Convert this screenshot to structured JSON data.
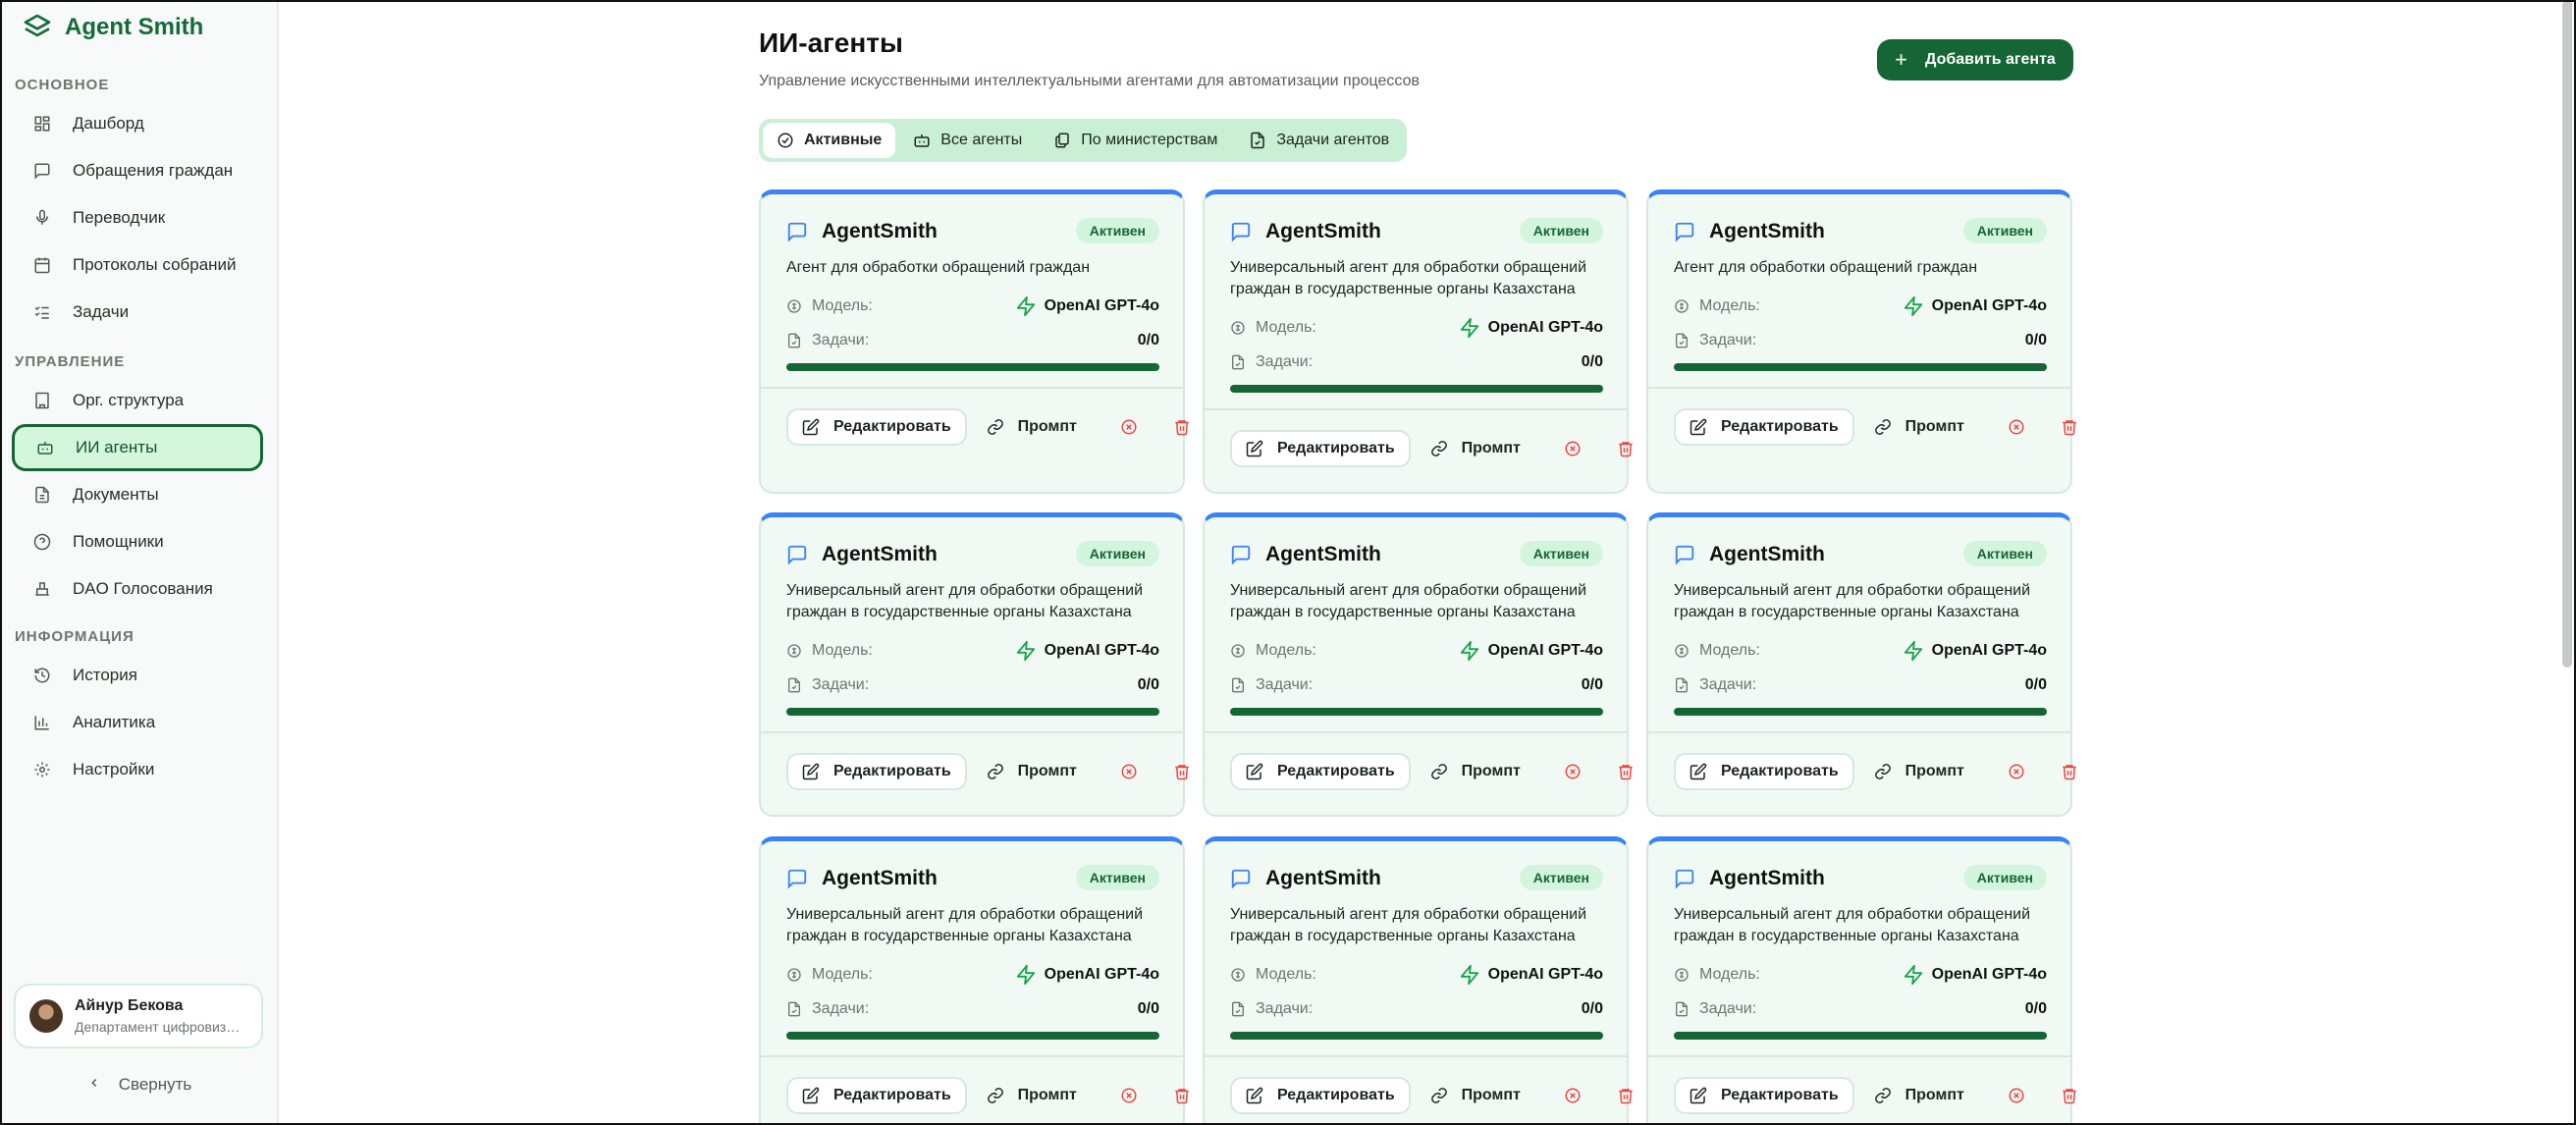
{
  "app": {
    "title": "Agent Smith"
  },
  "sidebar": {
    "sections": [
      {
        "label": "ОСНОВНОЕ"
      },
      {
        "label": "УПРАВЛЕНИЕ"
      },
      {
        "label": "ИНФОРМАЦИЯ"
      }
    ],
    "items": [
      {
        "label": "Дашборд",
        "icon": "dashboard-icon"
      },
      {
        "label": "Обращения граждан",
        "icon": "message-icon"
      },
      {
        "label": "Переводчик",
        "icon": "microphone-icon"
      },
      {
        "label": "Протоколы собраний",
        "icon": "calendar-icon"
      },
      {
        "label": "Задачи",
        "icon": "checklist-icon"
      },
      {
        "label": "Орг. структура",
        "icon": "building-icon"
      },
      {
        "label": "ИИ агенты",
        "icon": "bot-icon",
        "active": true
      },
      {
        "label": "Документы",
        "icon": "document-icon"
      },
      {
        "label": "Помощники",
        "icon": "help-circle-icon"
      },
      {
        "label": "DAO Голосования",
        "icon": "vote-icon"
      },
      {
        "label": "История",
        "icon": "history-icon"
      },
      {
        "label": "Аналитика",
        "icon": "chart-icon"
      },
      {
        "label": "Настройки",
        "icon": "gear-icon"
      }
    ],
    "user": {
      "name": "Айнур Бекова",
      "department": "Департамент цифровизации"
    },
    "collapse_label": "Свернуть"
  },
  "header": {
    "title": "ИИ-агенты",
    "subtitle": "Управление искусственными интеллектуальными агентами для автоматизации процессов",
    "add_button": "Добавить агента"
  },
  "tabs": [
    {
      "label": "Активные",
      "icon": "check-circle-icon",
      "active": true
    },
    {
      "label": "Все агенты",
      "icon": "bot-icon"
    },
    {
      "label": "По министерствам",
      "icon": "documents-icon"
    },
    {
      "label": "Задачи агентов",
      "icon": "file-check-icon"
    }
  ],
  "card_labels": {
    "model": "Модель:",
    "tasks": "Задачи:",
    "edit": "Редактировать",
    "prompt": "Промпт"
  },
  "colors": {
    "accent": "#166534",
    "card_top": "#3b82f6",
    "danger": "#ef4444",
    "active_bg": "#d4f6dd"
  },
  "agents": [
    {
      "name": "AgentSmith",
      "status": "Активен",
      "description": "Агент для обработки обращений граждан",
      "model": "OpenAI GPT-4o",
      "tasks": "0/0",
      "progress": 1.0
    },
    {
      "name": "AgentSmith",
      "status": "Активен",
      "description": "Универсальный агент для обработки обращений граждан в государственные органы Казахстана",
      "model": "OpenAI GPT-4o",
      "tasks": "0/0",
      "progress": 1.0
    },
    {
      "name": "AgentSmith",
      "status": "Активен",
      "description": "Агент для обработки обращений граждан",
      "model": "OpenAI GPT-4o",
      "tasks": "0/0",
      "progress": 1.0
    },
    {
      "name": "AgentSmith",
      "status": "Активен",
      "description": "Универсальный агент для обработки обращений граждан в государственные органы Казахстана",
      "model": "OpenAI GPT-4o",
      "tasks": "0/0",
      "progress": 1.0
    },
    {
      "name": "AgentSmith",
      "status": "Активен",
      "description": "Универсальный агент для обработки обращений граждан в государственные органы Казахстана",
      "model": "OpenAI GPT-4o",
      "tasks": "0/0",
      "progress": 1.0
    },
    {
      "name": "AgentSmith",
      "status": "Активен",
      "description": "Универсальный агент для обработки обращений граждан в государственные органы Казахстана",
      "model": "OpenAI GPT-4o",
      "tasks": "0/0",
      "progress": 1.0
    },
    {
      "name": "AgentSmith",
      "status": "Активен",
      "description": "Универсальный агент для обработки обращений граждан в государственные органы Казахстана",
      "model": "OpenAI GPT-4o",
      "tasks": "0/0",
      "progress": 1.0
    },
    {
      "name": "AgentSmith",
      "status": "Активен",
      "description": "Универсальный агент для обработки обращений граждан в государственные органы Казахстана",
      "model": "OpenAI GPT-4o",
      "tasks": "0/0",
      "progress": 1.0
    },
    {
      "name": "AgentSmith",
      "status": "Активен",
      "description": "Универсальный агент для обработки обращений граждан в государственные органы Казахстана",
      "model": "OpenAI GPT-4o",
      "tasks": "0/0",
      "progress": 1.0
    }
  ]
}
